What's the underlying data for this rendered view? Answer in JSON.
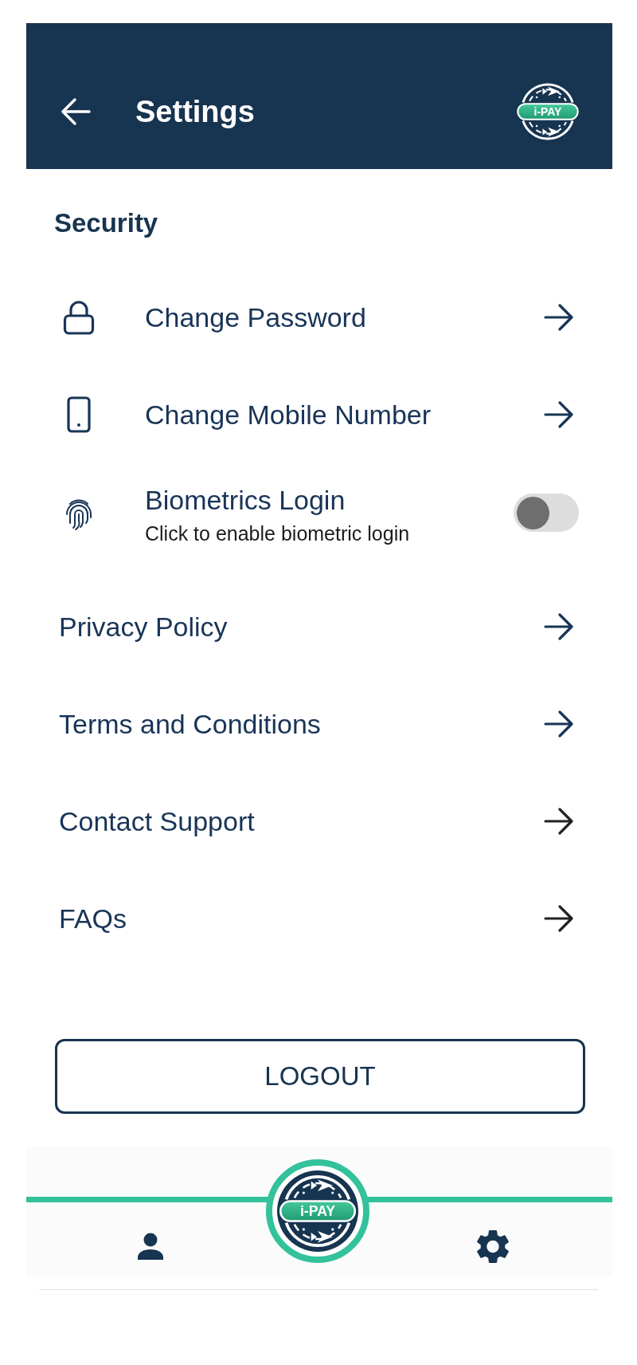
{
  "header": {
    "title": "Settings",
    "logo_text": "i-PAY"
  },
  "security": {
    "title": "Security",
    "items": [
      {
        "kind": "password",
        "label": "Change Password"
      },
      {
        "kind": "mobile",
        "label": "Change Mobile Number"
      },
      {
        "kind": "biometric",
        "label": "Biometrics Login",
        "subtitle": "Click to enable biometric login",
        "on": false
      }
    ]
  },
  "links": [
    {
      "label": "Privacy Policy",
      "color": "#183457"
    },
    {
      "label": "Terms and Conditions",
      "color": "#183457"
    },
    {
      "label": "Contact Support",
      "color": "#222222"
    },
    {
      "label": "FAQs",
      "color": "#222222"
    }
  ],
  "logout_button": "LOGOUT",
  "bottom_nav": [
    {
      "kind": "profile"
    },
    {
      "kind": "home",
      "logo_text": "i-PAY"
    },
    {
      "kind": "settings"
    }
  ]
}
